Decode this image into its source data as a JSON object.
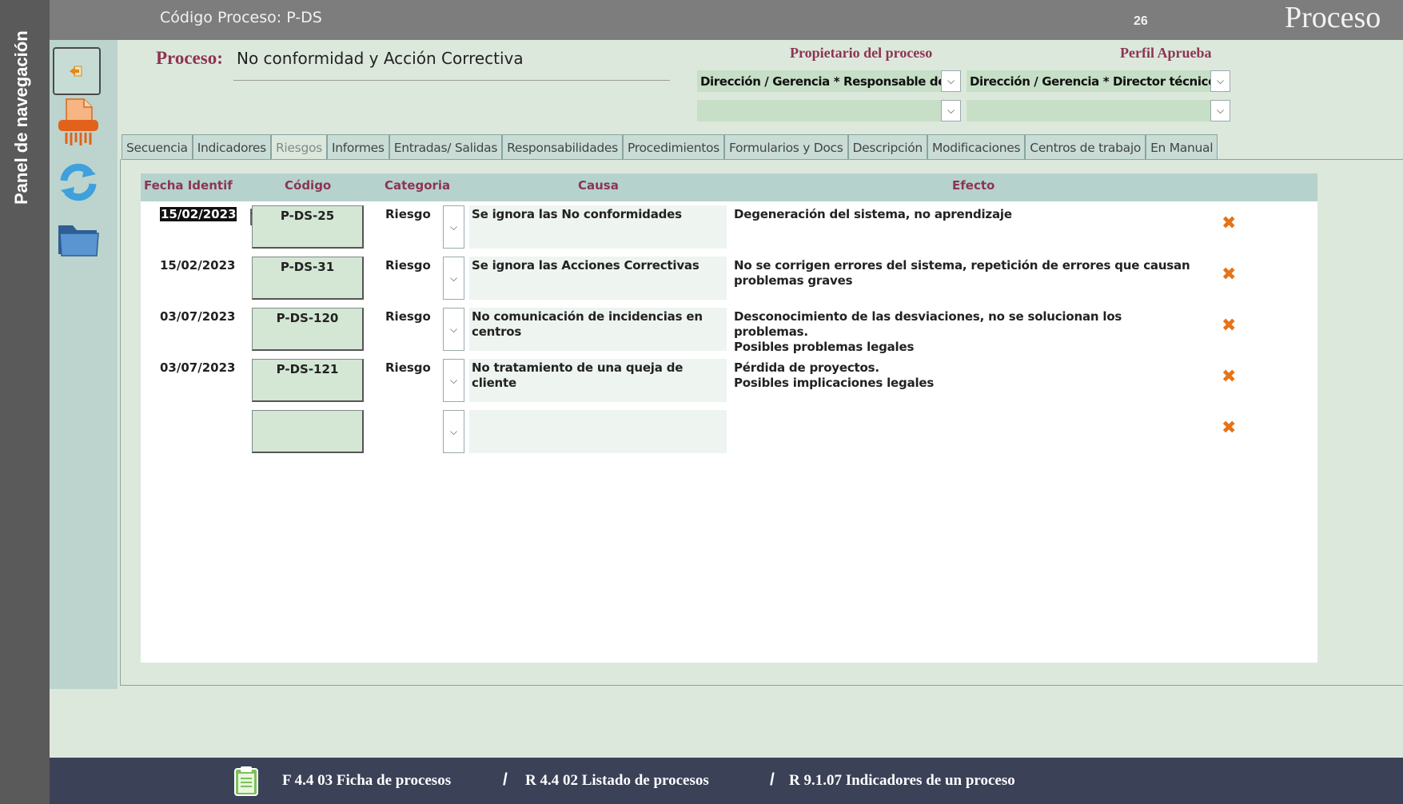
{
  "nav": {
    "title": "Panel de navegación"
  },
  "header": {
    "code_label": "Código Proceso: P-DS",
    "record_number": "26",
    "title": "Proceso"
  },
  "process": {
    "label": "Proceso:",
    "name": "No conformidad y Acción Correctiva",
    "owner_label": "Propietario del proceso",
    "approver_label": "Perfil Aprueba",
    "owner_value": "Dirección / Gerencia * Responsable de",
    "owner_value_2": "",
    "approver_value": "Dirección / Gerencia * Director técnico",
    "approver_value_2": ""
  },
  "tabs": [
    {
      "label": "Secuencia",
      "active": false
    },
    {
      "label": "Indicadores",
      "active": false
    },
    {
      "label": "Riesgos",
      "active": true
    },
    {
      "label": "Informes",
      "active": false
    },
    {
      "label": "Entradas/ Salidas",
      "active": false
    },
    {
      "label": "Responsabilidades",
      "active": false
    },
    {
      "label": "Procedimientos",
      "active": false
    },
    {
      "label": "Formularios y Docs",
      "active": false
    },
    {
      "label": "Descripción",
      "active": false
    },
    {
      "label": "Modificaciones",
      "active": false
    },
    {
      "label": "Centros de trabajo",
      "active": false
    },
    {
      "label": "En Manual",
      "active": false
    }
  ],
  "risks": {
    "columns": {
      "date": "Fecha Identif",
      "code": "Código",
      "category": "Categoria",
      "cause": "Causa",
      "effect": "Efecto"
    },
    "rows": [
      {
        "date": "15/02/2023",
        "code": "P-DS-25",
        "category": "Riesgo",
        "cause": "Se ignora las No conformidades",
        "effect": "Degeneración del sistema, no aprendizaje"
      },
      {
        "date": "15/02/2023",
        "code": "P-DS-31",
        "category": "Riesgo",
        "cause": "Se ignora las Acciones Correctivas",
        "effect": "No se corrigen errores del sistema, repetición de errores que causan problemas graves"
      },
      {
        "date": "03/07/2023",
        "code": "P-DS-120",
        "category": "Riesgo",
        "cause": "No comunicación de incidencias en centros",
        "effect": "Desconocimiento de las desviaciones, no se solucionan los problemas.\nPosibles problemas legales"
      },
      {
        "date": "03/07/2023",
        "code": "P-DS-121",
        "category": "Riesgo",
        "cause": "No tratamiento de una queja de cliente",
        "effect": "Pérdida de proyectos.\nPosibles implicaciones legales"
      },
      {
        "date": "",
        "code": "",
        "category": "",
        "cause": "",
        "effect": ""
      }
    ]
  },
  "footer": {
    "links": [
      "F 4.4 03 Ficha de procesos",
      "R 4.4 02 Listado de procesos",
      "R 9.1.07 Indicadores de un proceso"
    ],
    "separator": "/"
  },
  "icons": {
    "back": "back-arrow-icon",
    "shred": "document-shredder-icon",
    "refresh": "refresh-icon",
    "folder": "folder-icon",
    "calendar": "calendar-icon",
    "delete": "delete-x-icon",
    "clipboard": "clipboard-icon",
    "delete_glyph": "✖",
    "dropdown_glyph": "⌵"
  },
  "colors": {
    "accent": "#8c3553",
    "delete": "#e67317"
  }
}
